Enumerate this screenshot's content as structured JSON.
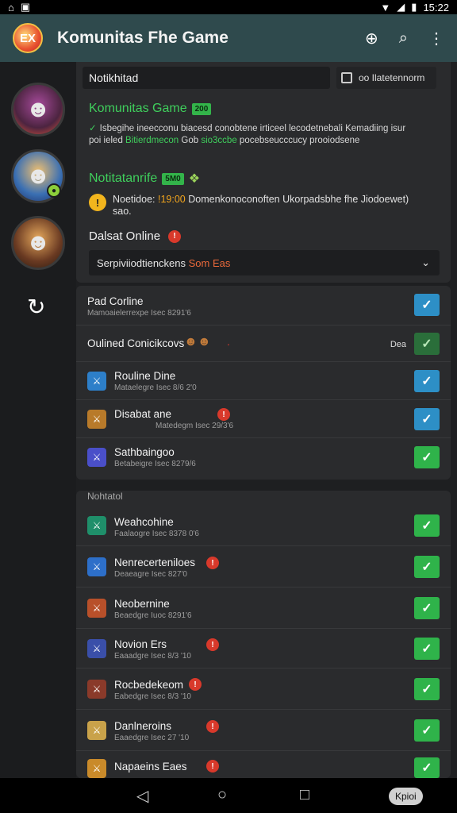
{
  "status_bar": {
    "time": "15:22",
    "battery_label": ""
  },
  "app_bar": {
    "logo_text": "EX",
    "title": "Komunitas Fhe Game",
    "icons": [
      "target-search-icon",
      "search-icon",
      "more-vert-icon"
    ]
  },
  "search": {
    "value": "Notikhitad",
    "filter_label": "oo  Ilatetennorm"
  },
  "community": {
    "title": "Komunitas Game",
    "tag": "200",
    "desc_line1": "Isbegihe ineecconu biacesd conobtene irticeel lecodetnebali Kemadiing isur",
    "desc_line2": "poi ieled",
    "desc_green1": "Bitierdmecon",
    "desc_mid": "Gob",
    "desc_green2": "sio3ccbe",
    "desc_rest": "pocebseucccucy prooiodsene"
  },
  "notifications": {
    "heading": "Notitatanrife",
    "tag": "5M0",
    "alert_prefix": "Noetidoe:",
    "alert_value": "!19:00",
    "alert_text": "Domenkonoconoften Ukorpadsbhe fhe Jiodoewet)",
    "alert_line2": "sao."
  },
  "online": {
    "heading": "Dalsat Online",
    "select_value": "Serpiviiodtienckens",
    "select_orange": "Som Eas"
  },
  "list1": [
    {
      "title": "Pad Corline",
      "sub": "Mamoaielerrexpe Isec 8291'6",
      "checked_style": "blue"
    },
    {
      "title": "Oulined Conicikcovs",
      "sub": "",
      "extra": "Dea",
      "checked_style": "dkgreen"
    },
    {
      "title": "Rouline Dine",
      "sub": "Mataelegre Isec 8/6 2'0",
      "checked_style": "blue"
    },
    {
      "title": "Disabat ane",
      "sub": "Matedegm Isec 29/3'6",
      "checked_style": "blue"
    },
    {
      "title": "Sathbaingoo",
      "sub": "Betabeigre Isec 8279/6",
      "checked_style": "green"
    }
  ],
  "section2_label": "Nohtatol",
  "list2": [
    {
      "title": "Weahcohine",
      "sub": "Faalaogre Isec 8378 0'6",
      "badge": false
    },
    {
      "title": "Nenrecerteniloes",
      "sub": "Deaeagre Isec 827'0",
      "badge": true
    },
    {
      "title": "Neobernine",
      "sub": "Beaedgre Iuoc 8291'6",
      "badge": false
    },
    {
      "title": "Novion Ers",
      "sub": "Eaaadgre Isec 8/3 '10",
      "badge": true
    },
    {
      "title": "Rocbedekeom",
      "sub": "Eabedgre Isec 8/3 '10",
      "badge": true
    },
    {
      "title": "Danlneroins",
      "sub": "Eaaedgre Isec 27 '10",
      "badge": true
    },
    {
      "title": "Napaeins Eaes",
      "sub": "",
      "badge": true
    }
  ],
  "nav_pill": "Kpioi",
  "colors": {
    "appbar": "#2f4a4d",
    "accent_green": "#3fcf5c",
    "check_blue": "#2d8fc6",
    "check_green": "#2fb34a",
    "alert_orange": "#f2a51d"
  }
}
